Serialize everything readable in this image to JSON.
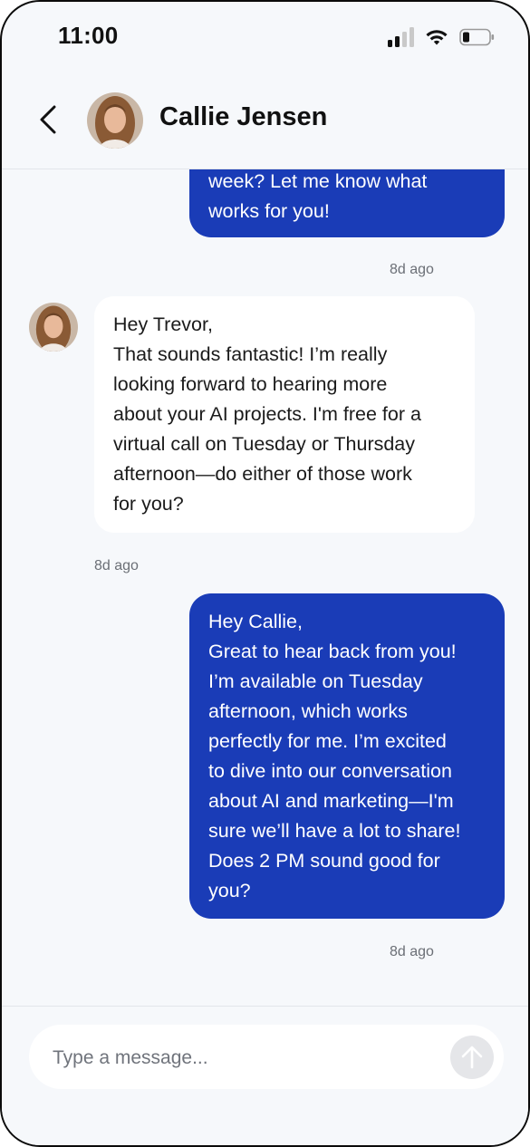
{
  "status_bar": {
    "time": "11:00"
  },
  "header": {
    "contact_name": "Callie Jensen"
  },
  "messages": [
    {
      "sender": "me",
      "lines": [
        "week? Let me know what",
        "works for you!"
      ],
      "timestamp": "8d ago"
    },
    {
      "sender": "contact",
      "lines": [
        "Hey Trevor,",
        "That sounds fantastic! I’m really",
        "looking forward to hearing more",
        "about your AI projects. I'm free for a",
        "virtual call on Tuesday or Thursday",
        "afternoon—do either of those work",
        "for you?"
      ],
      "timestamp": "8d ago"
    },
    {
      "sender": "me",
      "lines": [
        "Hey Callie,",
        "Great to hear back from you!",
        "I’m available on Tuesday",
        "afternoon, which works",
        "perfectly for me. I’m excited",
        "to dive into our conversation",
        "about AI and marketing—I'm",
        "sure we’ll have a lot to share!",
        "Does 2 PM sound good for",
        "you?"
      ],
      "timestamp": "8d ago"
    }
  ],
  "composer": {
    "placeholder": "Type a message..."
  },
  "icons": {
    "back": "chevron-left-icon",
    "send": "arrow-up-icon",
    "signal": "cellular-signal-icon",
    "wifi": "wifi-icon",
    "battery": "battery-icon"
  },
  "colors": {
    "sent_bubble": "#1a3cb7",
    "received_bubble": "#ffffff",
    "background": "#f6f8fb",
    "send_button": "#e5e6e9"
  }
}
